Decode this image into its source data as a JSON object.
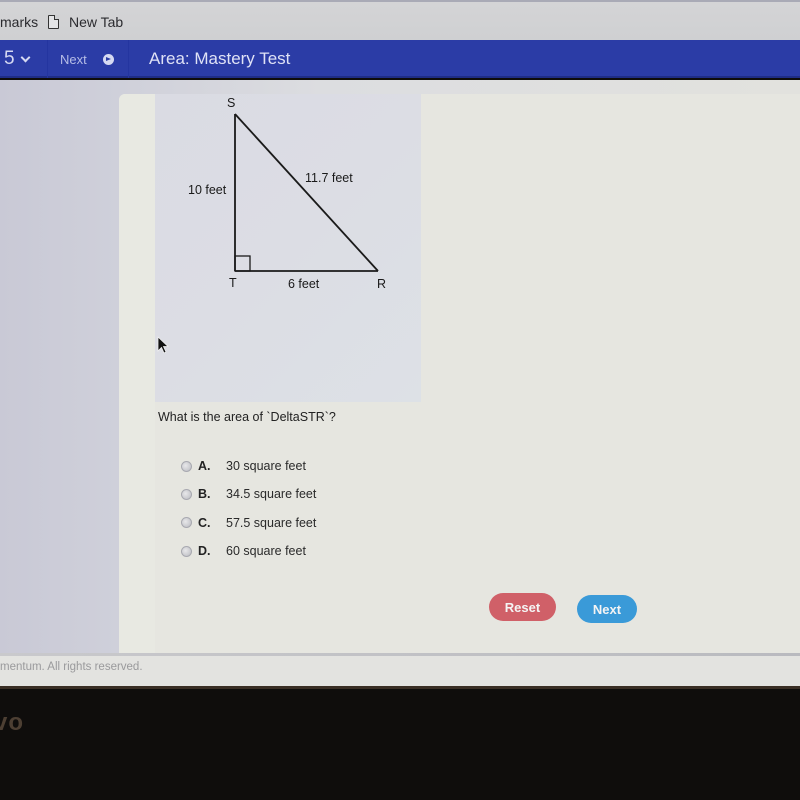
{
  "browser": {
    "bookmarks_label": "marks",
    "new_tab_label": "New Tab"
  },
  "nav": {
    "question_number": "5",
    "next_label": "Next",
    "title": "Area: Mastery Test",
    "accent_color": "#2b3ca6"
  },
  "figure": {
    "vertices": {
      "top": "S",
      "right_angle": "T",
      "right": "R"
    },
    "sides": {
      "ST": "10 feet",
      "SR": "11.7 feet",
      "TR": "6 feet"
    }
  },
  "question": {
    "text": "What is the area of `DeltaSTR`?",
    "options": [
      {
        "letter": "A.",
        "text": "30 square feet"
      },
      {
        "letter": "B.",
        "text": "34.5 square feet"
      },
      {
        "letter": "C.",
        "text": "57.5 square feet"
      },
      {
        "letter": "D.",
        "text": "60 square feet"
      }
    ]
  },
  "buttons": {
    "reset_label": "Reset",
    "next_label": "Next",
    "reset_color": "#d06068",
    "next_color": "#3a9ad8"
  },
  "footer": {
    "copyright": "mentum. All rights reserved."
  },
  "bezel": {
    "logo_text": "vo"
  }
}
